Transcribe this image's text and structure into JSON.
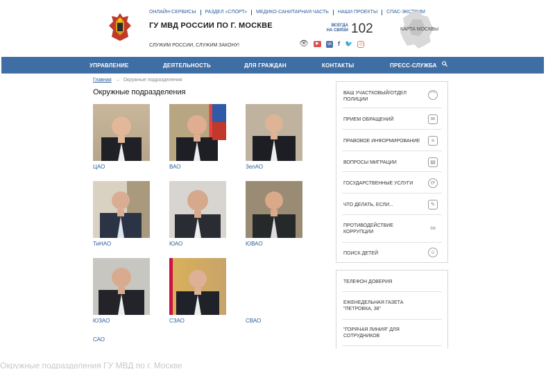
{
  "header": {
    "top_links": [
      "ОНЛАЙН-СЕРВИСЫ",
      "РАЗДЕЛ «СПОРТ»",
      "МЕДИКО-САНИТАРНАЯ ЧАСТЬ",
      "НАШИ ПРОЕКТЫ",
      "СПАС-ЭКСТРИМ"
    ],
    "title": "ГУ МВД РОССИИ ПО Г. МОСКВЕ",
    "slogan": "СЛУЖИМ РОССИИ, СЛУЖИМ ЗАКОНУ!",
    "hotline_label_1": "ВСЕГДА",
    "hotline_label_2": "НА СВЯЗИ",
    "hotline_number": "102",
    "map_label": "КАРТА МОСКВЫ",
    "social_icons": [
      "eye-icon",
      "youtube-icon",
      "vk-icon",
      "facebook-icon",
      "twitter-icon",
      "instagram-icon"
    ]
  },
  "nav": {
    "items": [
      "УПРАВЛЕНИЕ",
      "ДЕЯТЕЛЬНОСТЬ",
      "ДЛЯ ГРАЖДАН",
      "КОНТАКТЫ",
      "ПРЕСС-СЛУЖБА"
    ],
    "search_icon": "search-icon"
  },
  "breadcrumb": {
    "home": "Главная",
    "separator": "→",
    "current": "Окружные подразделения"
  },
  "page_title": "Окружные подразделения",
  "districts": [
    "ЦАО",
    "ВАО",
    "ЗелАО",
    "ТиНАО",
    "ЮАО",
    "ЮВАО",
    "ЮЗАО",
    "СЗАО",
    "СВАО",
    "САО"
  ],
  "sidebar": {
    "items": [
      {
        "label": "ВАШ УЧАСТКОВЫЙ/ОТДЕЛ ПОЛИЦИИ",
        "icon": "officer-cap-icon"
      },
      {
        "label": "ПРИЕМ ОБРАЩЕНИЙ",
        "icon": "letter-icon"
      },
      {
        "label": "ПРАВОВОЕ ИНФОРМИРОВАНИЕ",
        "icon": "document-icon"
      },
      {
        "label": "ВОПРОСЫ МИГРАЦИИ",
        "icon": "passport-icon"
      },
      {
        "label": "ГОСУДАРСТВЕННЫЕ УСЛУГИ",
        "icon": "services-icon"
      },
      {
        "label": "ЧТО ДЕЛАТЬ, ЕСЛИ...",
        "icon": "pencil-icon"
      },
      {
        "label": "ПРОТИВОДЕЙСТВИЕ КОРРУПЦИИ",
        "icon": "handcuffs-icon"
      },
      {
        "label": "ПОИСК ДЕТЕЙ",
        "icon": "child-icon"
      }
    ],
    "links": [
      "ТЕЛЕФОН ДОВЕРИЯ",
      "ЕЖЕНЕДЕЛЬНАЯ ГАЗЕТА \"ПЕТРОВКА, 38\"",
      "\"ГОРЯЧАЯ ЛИНИЯ\" ДЛЯ СОТРУДНИКОВ"
    ]
  },
  "footer_partial": "Окружные подразделения ГУ МВД по г. Москве"
}
